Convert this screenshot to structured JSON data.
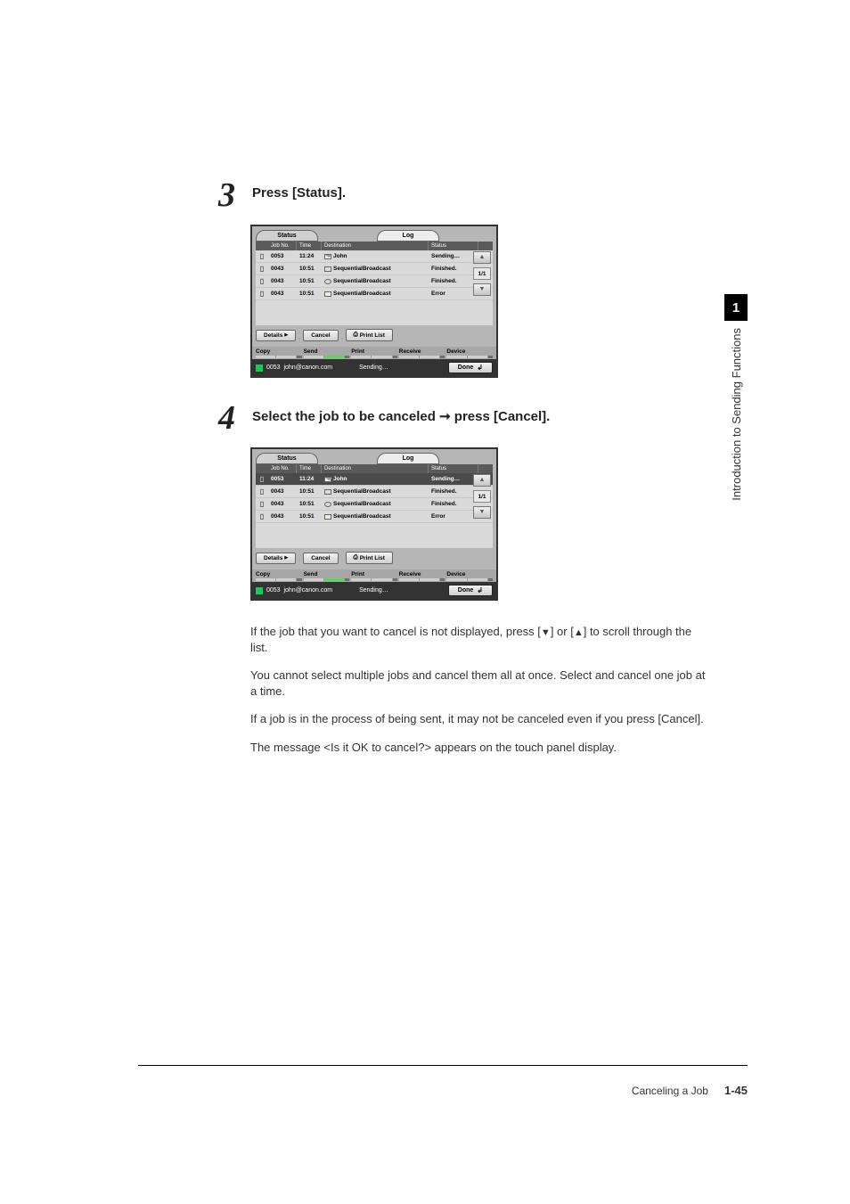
{
  "steps": {
    "s3": {
      "num": "3",
      "text": "Press [Status]."
    },
    "s4": {
      "num": "4",
      "text_a": "Select the job to be canceled ",
      "text_b": " press [Cancel]."
    }
  },
  "panel": {
    "tabs": {
      "status": "Status",
      "log": "Log"
    },
    "headers": {
      "job": "Job No.",
      "time": "Time",
      "dest": "Destination",
      "status": "Status"
    },
    "rows": [
      {
        "job": "0053",
        "time": "11:24",
        "icon": "envelope",
        "dest": "John",
        "status": "Sending…"
      },
      {
        "job": "0043",
        "time": "10:51",
        "icon": "fax",
        "dest": "SequentialBroadcast",
        "status": "Finished."
      },
      {
        "job": "0043",
        "time": "10:51",
        "icon": "globe",
        "dest": "SequentialBroadcast",
        "status": "Finished."
      },
      {
        "job": "0043",
        "time": "10:51",
        "icon": "box",
        "dest": "SequentialBroadcast",
        "status": "Error"
      }
    ],
    "pager": "1/1",
    "buttons": {
      "details": "Details",
      "cancel": "Cancel",
      "printlist": "Print List"
    },
    "bottomTabs": {
      "copy": "Copy",
      "send": "Send",
      "print": "Print",
      "receive": "Receive",
      "device": "Device"
    },
    "statusbar": {
      "id": "0053",
      "addr": "john@canon.com",
      "state": "Sending…",
      "done": "Done"
    }
  },
  "paras": {
    "p1a": "If the job that you want to cancel is not displayed, press [",
    "p1b": "] or [",
    "p1c": "] to scroll through the list.",
    "p2": "You cannot select multiple jobs and cancel them all at once. Select and cancel one job at a time.",
    "p3": "If a job is in the process of being sent, it may not be canceled even if you press [Cancel].",
    "p4": "The message <Is it OK to cancel?> appears on the touch panel display."
  },
  "side": {
    "chapter": "1",
    "label": "Introduction to Sending Functions"
  },
  "footer": {
    "title": "Canceling a Job",
    "page": "1-45"
  }
}
